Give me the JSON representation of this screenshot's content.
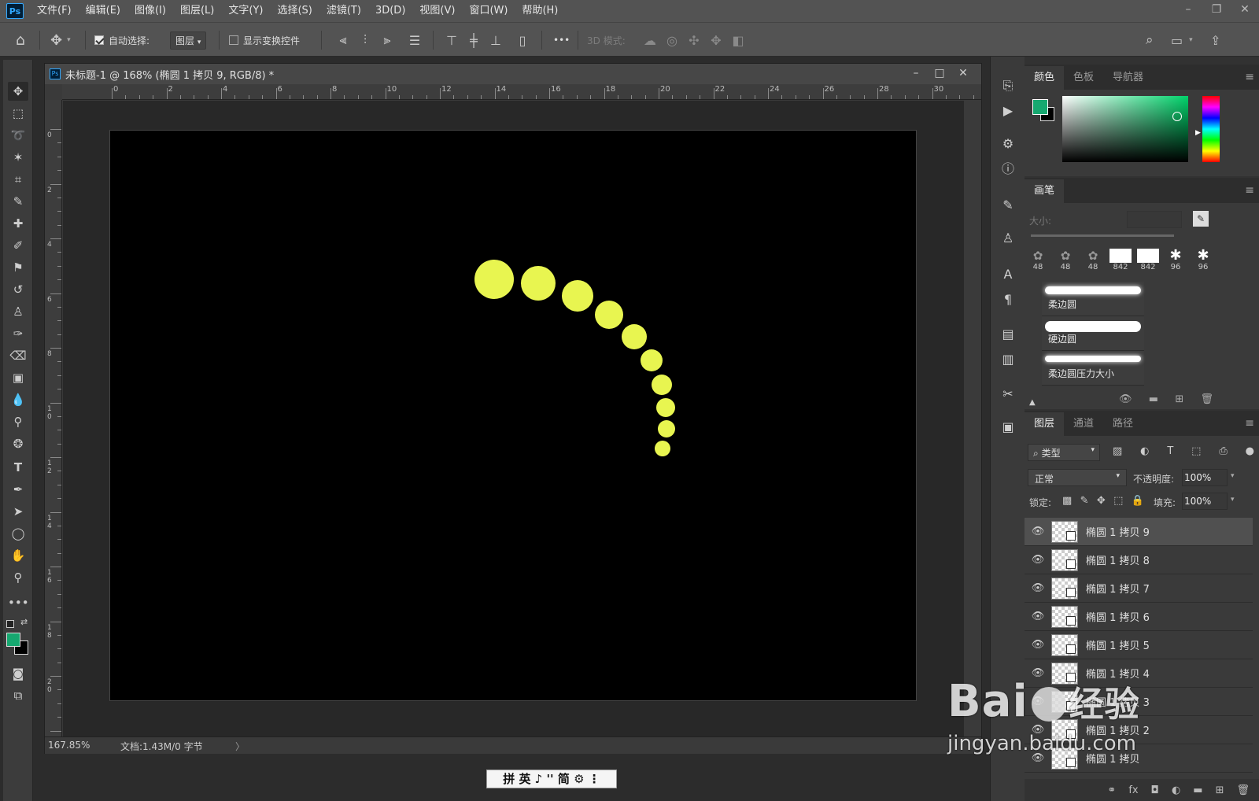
{
  "app": {
    "logo": "Ps"
  },
  "menu": [
    "文件(F)",
    "编辑(E)",
    "图像(I)",
    "图层(L)",
    "文字(Y)",
    "选择(S)",
    "滤镜(T)",
    "3D(D)",
    "视图(V)",
    "窗口(W)",
    "帮助(H)"
  ],
  "options": {
    "auto_select_label": "自动选择:",
    "auto_select_checked": true,
    "auto_select_target": "图层",
    "show_transform_label": "显示变换控件",
    "mode_3d_label": "3D 模式:",
    "more": "•••"
  },
  "document": {
    "title": "未标题-1 @ 168% (椭圆 1 拷贝 9, RGB/8) *",
    "zoom": "167.85%",
    "doc_info": "文档:1.43M/0 字节",
    "hruler_labels": [
      "0",
      "2",
      "4",
      "6",
      "8",
      "10",
      "12",
      "14",
      "16",
      "18",
      "20",
      "22",
      "24",
      "26",
      "28",
      "30"
    ],
    "vruler_labels": [
      "0",
      "2",
      "4",
      "6",
      "8",
      "1\n0",
      "1\n2",
      "1\n4",
      "1\n6",
      "1\n8",
      "2\n0"
    ],
    "canvas_bg": "#000000",
    "dot_color": "#e8f550"
  },
  "color_panel": {
    "tabs": [
      "颜色",
      "色板",
      "导航器"
    ],
    "foreground": "#16a870",
    "background": "#000000"
  },
  "brush_panel": {
    "tab": "画笔",
    "size_label": "大小:",
    "presets": [
      "48",
      "48",
      "48",
      "842",
      "842",
      "96",
      "96"
    ],
    "strokes": [
      "柔边圆",
      "硬边圆",
      "柔边圆压力大小"
    ]
  },
  "layers_panel": {
    "tabs": [
      "图层",
      "通道",
      "路径"
    ],
    "filter_label": "类型",
    "blend_mode": "正常",
    "opacity_label": "不透明度:",
    "opacity": "100%",
    "lock_label": "锁定:",
    "fill_label": "填充:",
    "fill": "100%",
    "layers": [
      "椭圆 1 拷贝 9",
      "椭圆 1 拷贝 8",
      "椭圆 1 拷贝 7",
      "椭圆 1 拷贝 6",
      "椭圆 1 拷贝 5",
      "椭圆 1 拷贝 4",
      "椭圆 1 拷贝 3",
      "椭圆 1 拷贝 2",
      "椭圆 1 拷贝"
    ]
  },
  "ime": "拼 英 ♪ '' 简 ⚙ ⋮",
  "watermark": {
    "brand": "Bai",
    "brand2": "经验",
    "url": "jingyan.baidu.com"
  }
}
